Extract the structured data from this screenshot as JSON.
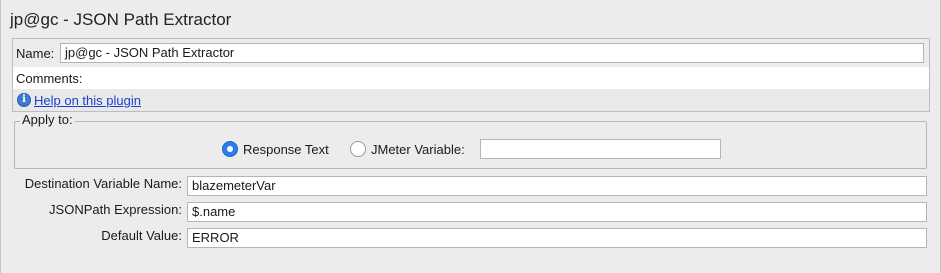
{
  "title": "jp@gc - JSON Path Extractor",
  "name_field": {
    "label": "Name:",
    "value": "jp@gc - JSON Path Extractor"
  },
  "comments": {
    "label": "Comments:"
  },
  "help": {
    "icon": "info-icon",
    "link_text": "Help on this plugin"
  },
  "apply_to": {
    "legend": "Apply to:",
    "options": [
      {
        "label": "Response Text",
        "selected": true
      },
      {
        "label": "JMeter Variable:",
        "selected": false
      }
    ],
    "jmeter_variable_value": ""
  },
  "fields": {
    "destination": {
      "label": "Destination Variable Name:",
      "value": "blazemeterVar"
    },
    "jsonpath": {
      "label": "JSONPath Expression:",
      "value": "$.name"
    },
    "default_value": {
      "label": "Default Value:",
      "value": "ERROR"
    }
  },
  "colors": {
    "accent": "#2b7de9",
    "link": "#1a3fd1"
  }
}
